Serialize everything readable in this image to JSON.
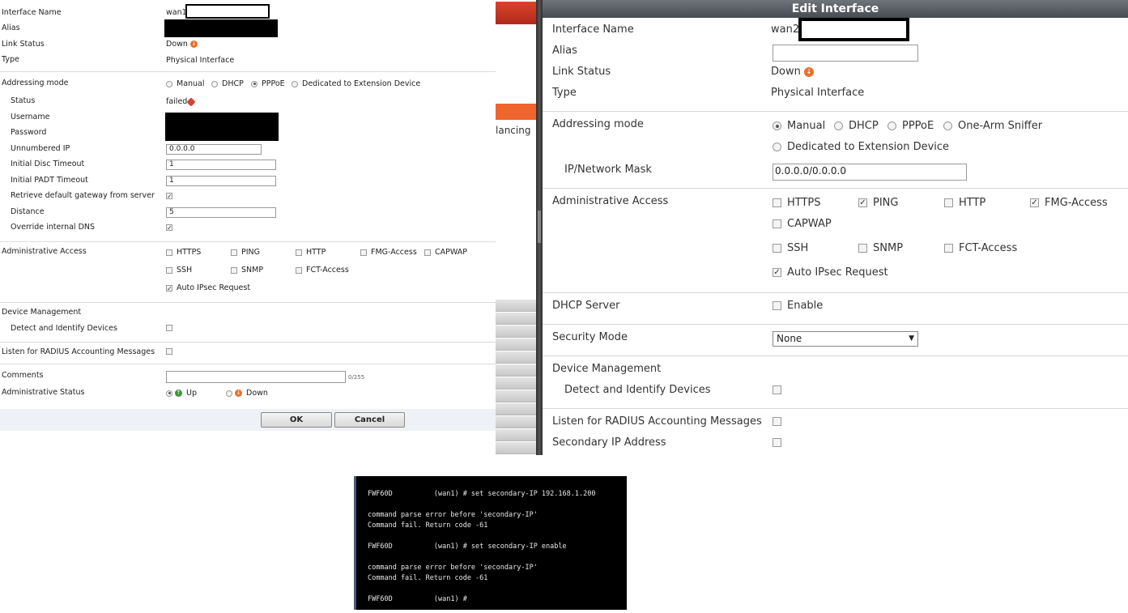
{
  "left_panel": {
    "interface_name_label": "Interface Name",
    "interface_name_value": "wan1",
    "alias_label": "Alias",
    "link_status_label": "Link Status",
    "link_status_value": "Down",
    "type_label": "Type",
    "type_value": "Physical Interface",
    "addressing_mode_label": "Addressing mode",
    "addressing_modes": [
      "Manual",
      "DHCP",
      "PPPoE",
      "Dedicated to Extension Device"
    ],
    "addressing_mode_selected": "PPPoE",
    "status_label": "Status",
    "status_value": "failed",
    "username_label": "Username",
    "password_label": "Password",
    "unnumbered_ip_label": "Unnumbered IP",
    "unnumbered_ip_value": "0.0.0.0",
    "initial_disc_timeout_label": "Initial Disc Timeout",
    "initial_disc_timeout_value": "1",
    "initial_padt_timeout_label": "Initial PADT Timeout",
    "initial_padt_timeout_value": "1",
    "retrieve_gateway_label": "Retrieve default gateway from server",
    "distance_label": "Distance",
    "distance_value": "5",
    "override_dns_label": "Override internal DNS",
    "admin_access_label": "Administrative Access",
    "admin_access_options": [
      "HTTPS",
      "PING",
      "HTTP",
      "FMG-Access",
      "CAPWAP",
      "SSH",
      "SNMP",
      "FCT-Access",
      "Auto IPsec Request"
    ],
    "device_management_label": "Device Management",
    "detect_devices_label": "Detect and Identify Devices",
    "radius_label": "Listen for RADIUS Accounting Messages",
    "comments_label": "Comments",
    "comments_counter": "0/255",
    "admin_status_label": "Administrative Status",
    "admin_status_up": "Up",
    "admin_status_down": "Down",
    "ok_label": "OK",
    "cancel_label": "Cancel"
  },
  "middle_strip": {
    "partial_text": "lancing"
  },
  "right_panel": {
    "title": "Edit Interface",
    "interface_name_label": "Interface Name",
    "interface_name_value": "wan2(",
    "alias_label": "Alias",
    "link_status_label": "Link Status",
    "link_status_value": "Down",
    "type_label": "Type",
    "type_value": "Physical Interface",
    "addressing_mode_label": "Addressing mode",
    "addressing_modes": [
      "Manual",
      "DHCP",
      "PPPoE",
      "One-Arm Sniffer",
      "Dedicated to Extension Device"
    ],
    "addressing_mode_selected": "Manual",
    "ip_mask_label": "IP/Network Mask",
    "ip_mask_value": "0.0.0.0/0.0.0.0",
    "admin_access_label": "Administrative Access",
    "admin_access_options": [
      "HTTPS",
      "PING",
      "HTTP",
      "FMG-Access",
      "CAPWAP",
      "SSH",
      "SNMP",
      "FCT-Access",
      "Auto IPsec Request"
    ],
    "dhcp_server_label": "DHCP Server",
    "dhcp_enable_label": "Enable",
    "security_mode_label": "Security Mode",
    "security_mode_value": "None",
    "device_management_label": "Device Management",
    "detect_devices_label": "Detect and Identify Devices",
    "radius_label": "Listen for RADIUS Accounting Messages",
    "secondary_ip_label": "Secondary IP Address"
  },
  "terminal": {
    "lines": [
      "FWF60D          (wan1) # set secondary-IP 192.168.1.200",
      "",
      "command parse error before 'secondary-IP'",
      "Command fail. Return code -61",
      "",
      "FWF60D          (wan1) # set secondary-IP enable",
      "",
      "command parse error before 'secondary-IP'",
      "Command fail. Return code -61",
      "",
      "FWF60D          (wan1) #"
    ]
  },
  "colors": {
    "status_down": "#e8702a",
    "status_up": "#3a9a32",
    "title_bar": "#5a5f66",
    "orange_tab": "#f0642e"
  }
}
